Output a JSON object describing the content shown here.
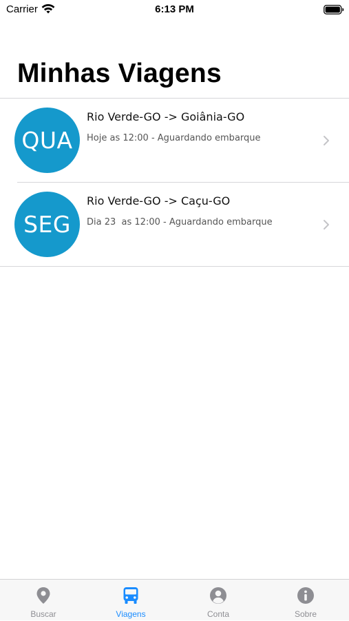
{
  "status_bar": {
    "carrier": "Carrier",
    "time": "6:13 PM"
  },
  "page": {
    "title": "Minhas Viagens"
  },
  "trips": [
    {
      "day": "QUA",
      "route": "Rio Verde-GO -> Goiânia-GO",
      "details": "Hoje as 12:00 - Aguardando embarque"
    },
    {
      "day": "SEG",
      "route": "Rio Verde-GO -> Caçu-GO",
      "details": "Dia 23  as 12:00 - Aguardando embarque"
    }
  ],
  "tab_bar": {
    "tabs": [
      {
        "label": "Buscar",
        "icon": "map-pin-icon",
        "active": false
      },
      {
        "label": "Viagens",
        "icon": "bus-icon",
        "active": true
      },
      {
        "label": "Conta",
        "icon": "user-circle-icon",
        "active": false
      },
      {
        "label": "Sobre",
        "icon": "info-icon",
        "active": false
      }
    ]
  },
  "colors": {
    "accent": "#1a8cff",
    "badge": "#1599cc",
    "inactive_tab": "#8e8e93"
  }
}
